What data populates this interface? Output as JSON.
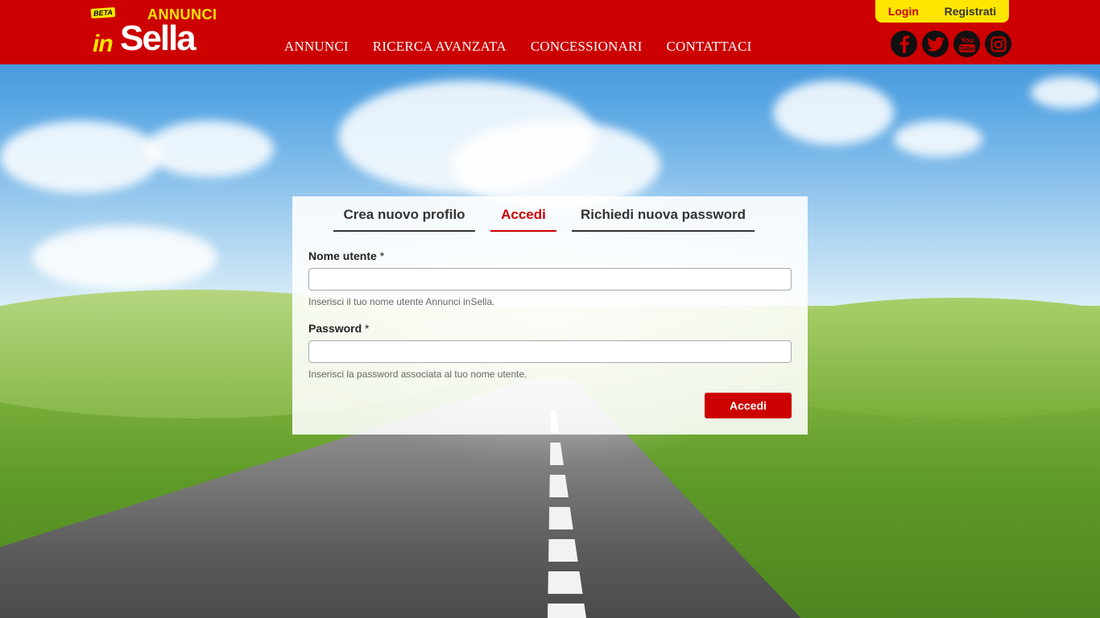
{
  "brand": {
    "beta": "BETA",
    "annunci": "ANNUNCI",
    "in": "in",
    "sella": "Sella"
  },
  "nav": {
    "items": [
      {
        "label": "ANNUNCI"
      },
      {
        "label": "RICERCA AVANZATA"
      },
      {
        "label": "CONCESSIONARI"
      },
      {
        "label": "CONTATTACI"
      }
    ]
  },
  "auth": {
    "login": "Login",
    "register": "Registrati"
  },
  "social": {
    "icons": [
      "facebook-icon",
      "twitter-icon",
      "youtube-icon",
      "instagram-icon"
    ],
    "youtube_text": "You\nTube"
  },
  "tabs": [
    {
      "label": "Crea nuovo profilo",
      "active": false
    },
    {
      "label": "Accedi",
      "active": true
    },
    {
      "label": "Richiedi nuova password",
      "active": false
    }
  ],
  "form": {
    "username": {
      "label": "Nome utente",
      "required_mark": "*",
      "value": "",
      "help": "Inserisci il tuo nome utente Annunci inSella."
    },
    "password": {
      "label": "Password",
      "required_mark": "*",
      "value": "",
      "help": "Inserisci la password associata al tuo nome utente."
    },
    "submit_label": "Accedi"
  },
  "colors": {
    "brand_red": "#cc0000",
    "brand_yellow": "#ffe600",
    "header_text": "#ffffff"
  }
}
